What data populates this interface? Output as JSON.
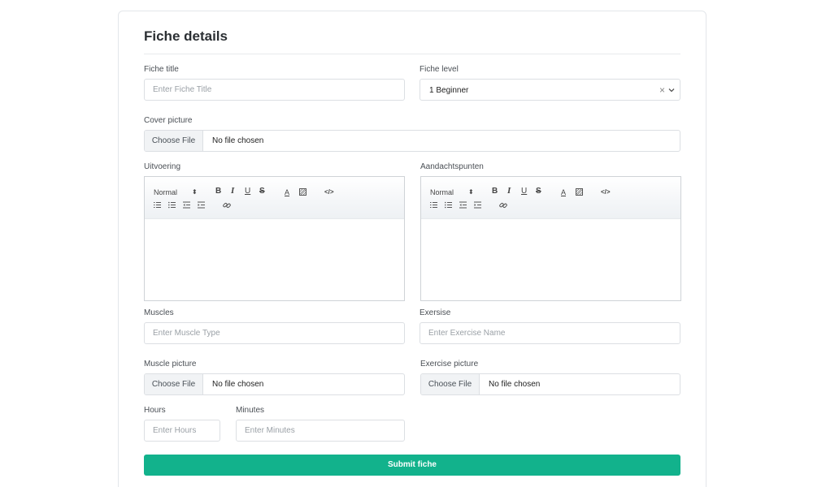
{
  "form": {
    "title": "Fiche details",
    "fiche_title": {
      "label": "Fiche title",
      "placeholder": "Enter Fiche Title",
      "value": ""
    },
    "fiche_level": {
      "label": "Fiche level",
      "value": "1 Beginner",
      "clear": "×"
    },
    "cover_picture": {
      "label": "Cover picture",
      "button": "Choose File",
      "status": "No file chosen"
    },
    "uitvoering": {
      "label": "Uitvoering"
    },
    "aandachtspunten": {
      "label": "Aandachtspunten"
    },
    "editor_toolbar": {
      "format": "Normal",
      "arrows": "⬍",
      "bold": "B",
      "italic": "I",
      "underline": "U",
      "strike": "S",
      "color": "A",
      "code": "</>"
    },
    "muscles": {
      "label": "Muscles",
      "placeholder": "Enter Muscle Type",
      "value": ""
    },
    "exersise": {
      "label": "Exersise",
      "placeholder": "Enter Exercise Name",
      "value": ""
    },
    "muscle_picture": {
      "label": "Muscle picture",
      "button": "Choose File",
      "status": "No file chosen"
    },
    "exercise_picture": {
      "label": "Exercise picture",
      "button": "Choose File",
      "status": "No file chosen"
    },
    "hours": {
      "label": "Hours",
      "placeholder": "Enter Hours",
      "value": ""
    },
    "minutes": {
      "label": "Minutes",
      "placeholder": "Enter Minutes",
      "value": ""
    },
    "submit_label": "Submit fiche"
  },
  "colors": {
    "accent": "#12b28c",
    "border": "#dcdfe3",
    "muted": "#9aa0a6"
  },
  "icons": [
    "chevron-down-icon",
    "clear-icon",
    "ordered-list-icon",
    "bullet-list-icon",
    "outdent-icon",
    "indent-icon",
    "link-icon",
    "background-color-icon",
    "code-icon"
  ]
}
